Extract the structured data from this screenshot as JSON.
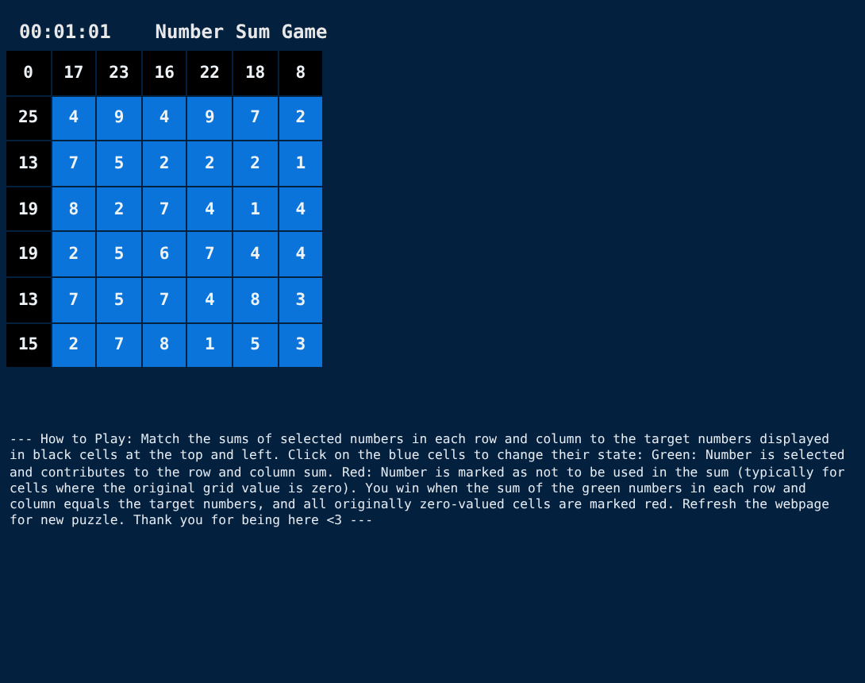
{
  "timer": "00:01:01",
  "title": "Number Sum Game",
  "corner": "0",
  "column_targets": [
    "17",
    "23",
    "16",
    "22",
    "18",
    "8"
  ],
  "rows": [
    {
      "target": "25",
      "cells": [
        {
          "value": "4",
          "selected": false,
          "excluded": false
        },
        {
          "value": "9",
          "selected": false,
          "excluded": false
        },
        {
          "value": "4",
          "selected": false,
          "excluded": false
        },
        {
          "value": "9",
          "selected": false,
          "excluded": false
        },
        {
          "value": "7",
          "selected": false,
          "excluded": false
        },
        {
          "value": "2",
          "selected": false,
          "excluded": false
        }
      ]
    },
    {
      "target": "13",
      "cells": [
        {
          "value": "7",
          "selected": false,
          "excluded": false
        },
        {
          "value": "5",
          "selected": false,
          "excluded": false
        },
        {
          "value": "2",
          "selected": false,
          "excluded": false
        },
        {
          "value": "2",
          "selected": false,
          "excluded": false
        },
        {
          "value": "2",
          "selected": false,
          "excluded": false
        },
        {
          "value": "1",
          "selected": false,
          "excluded": false
        }
      ]
    },
    {
      "target": "19",
      "cells": [
        {
          "value": "8",
          "selected": false,
          "excluded": false
        },
        {
          "value": "2",
          "selected": false,
          "excluded": false
        },
        {
          "value": "7",
          "selected": false,
          "excluded": false
        },
        {
          "value": "4",
          "selected": false,
          "excluded": false
        },
        {
          "value": "1",
          "selected": false,
          "excluded": false
        },
        {
          "value": "4",
          "selected": false,
          "excluded": false
        }
      ]
    },
    {
      "target": "19",
      "cells": [
        {
          "value": "2",
          "selected": false,
          "excluded": false
        },
        {
          "value": "5",
          "selected": false,
          "excluded": false
        },
        {
          "value": "6",
          "selected": false,
          "excluded": false
        },
        {
          "value": "7",
          "selected": false,
          "excluded": false
        },
        {
          "value": "4",
          "selected": false,
          "excluded": false
        },
        {
          "value": "4",
          "selected": false,
          "excluded": false
        }
      ]
    },
    {
      "target": "13",
      "cells": [
        {
          "value": "7",
          "selected": false,
          "excluded": false
        },
        {
          "value": "5",
          "selected": false,
          "excluded": false
        },
        {
          "value": "7",
          "selected": false,
          "excluded": false
        },
        {
          "value": "4",
          "selected": false,
          "excluded": false
        },
        {
          "value": "8",
          "selected": false,
          "excluded": false
        },
        {
          "value": "3",
          "selected": false,
          "excluded": false
        }
      ]
    },
    {
      "target": "15",
      "cells": [
        {
          "value": "2",
          "selected": false,
          "excluded": false
        },
        {
          "value": "7",
          "selected": false,
          "excluded": false
        },
        {
          "value": "8",
          "selected": false,
          "excluded": false
        },
        {
          "value": "1",
          "selected": false,
          "excluded": false
        },
        {
          "value": "5",
          "selected": false,
          "excluded": false
        },
        {
          "value": "3",
          "selected": false,
          "excluded": false
        }
      ]
    }
  ],
  "instructions": "--- How to Play: Match the sums of selected numbers in each row and column to the target numbers displayed in black cells at the top and left. Click on the blue cells to change their state: Green: Number is selected and contributes to the row and column sum. Red: Number is marked as not to be used in the sum (typically for cells where the original grid value is zero). You win when the sum of the green numbers in each row and column equals the target numbers, and all originally zero-valued cells are marked red. Refresh the webpage for new puzzle. Thank you for being here <3 ---"
}
